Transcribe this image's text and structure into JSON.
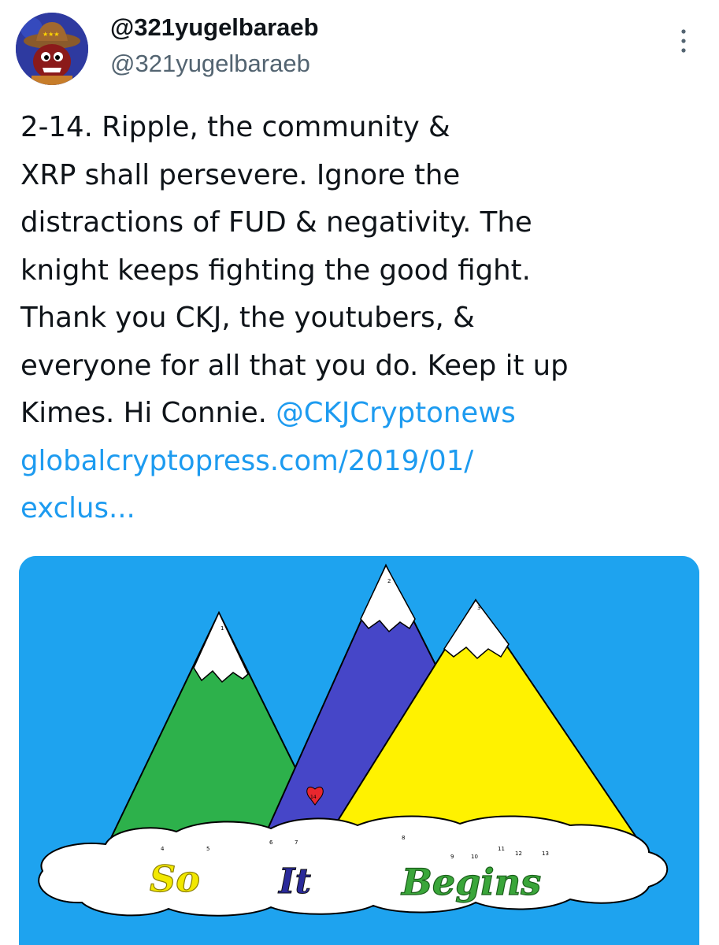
{
  "author": {
    "display_name": "@321yugelbaraeb",
    "handle": "@321yugelbaraeb"
  },
  "tweet": {
    "lines": [
      "2-14. Ripple, the community &",
      "XRP shall persevere. Ignore the",
      "distractions of FUD & negativity. The",
      "knight keeps fighting the good fight.",
      "Thank you CKJ, the youtubers, &",
      "everyone for all that you do. Keep it up"
    ],
    "line7_text": "Kimes. Hi Connie. ",
    "mention": "@CKJCryptonews",
    "link_line1": "globalcryptopress.com/2019/01/",
    "link_line2": "exclus..."
  },
  "image": {
    "colors": {
      "sky": "#1ea3ef",
      "green_mountain": "#2db14b",
      "blue_mountain": "#4646c8",
      "yellow_mountain": "#fff200",
      "heart": "#e8272e",
      "word_so": "#f2e800",
      "word_it": "#2a2a9a",
      "word_begins": "#3aa63a"
    },
    "peak_labels": [
      "1",
      "2",
      "3"
    ],
    "heart_label": "14",
    "cloud_numbers": [
      "4",
      "5",
      "6",
      "7",
      "8",
      "9",
      "10",
      "11",
      "12",
      "13"
    ],
    "words": [
      "So",
      "It",
      "Begins"
    ]
  },
  "icons": {
    "more": "more-vertical-icon"
  }
}
